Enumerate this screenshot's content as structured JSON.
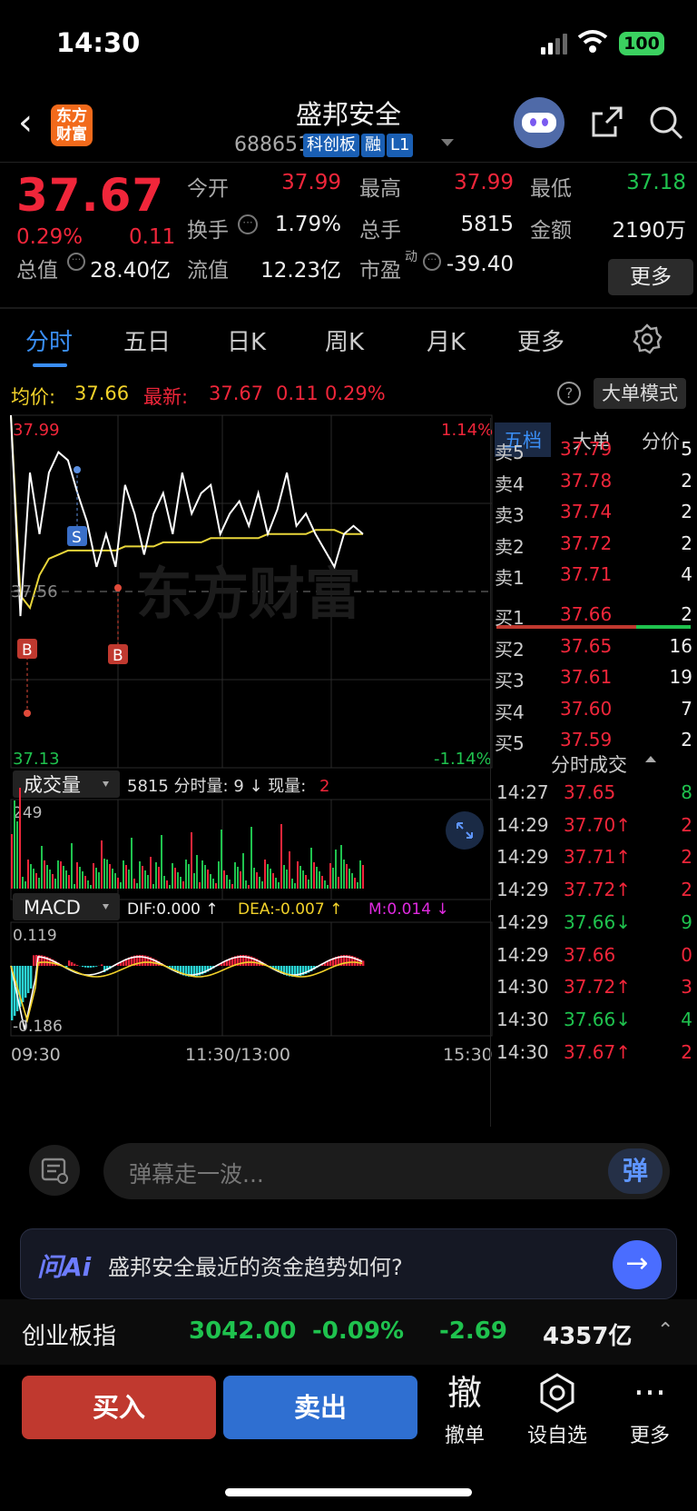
{
  "status": {
    "time": "14:30",
    "battery": "100"
  },
  "header": {
    "logo_text": "东方\n财富",
    "name": "盛邦安全",
    "code": "688651",
    "tags": [
      "科创板",
      "融",
      "L1"
    ]
  },
  "quote": {
    "price": "37.67",
    "change_pct": "0.29%",
    "change": "0.11",
    "fields": [
      {
        "label": "今开",
        "value": "37.99",
        "color": "red"
      },
      {
        "label": "最高",
        "value": "37.99",
        "color": "red"
      },
      {
        "label": "最低",
        "value": "37.18",
        "color": "green"
      },
      {
        "label": "换手",
        "value": "1.79%",
        "color": "white"
      },
      {
        "label": "总手",
        "value": "5815",
        "color": "white"
      },
      {
        "label": "金额",
        "value": "2190万",
        "color": "white"
      },
      {
        "label": "总值",
        "value": "28.40亿",
        "color": "white"
      },
      {
        "label": "流值",
        "value": "12.23亿",
        "color": "white"
      },
      {
        "label": "市盈",
        "sup": "动",
        "value": "-39.40",
        "color": "white"
      }
    ],
    "more": "更多"
  },
  "tabs": [
    "分时",
    "五日",
    "日K",
    "周K",
    "月K",
    "更多"
  ],
  "infoline": {
    "avg_label": "均价:",
    "avg": "37.66",
    "last_label": "最新:",
    "last": "37.67",
    "chg": "0.11",
    "pct": "0.29%",
    "help": "?",
    "big_order_mode": "大单模式"
  },
  "chart_labels": {
    "high": "37.99",
    "high_pct": "1.14%",
    "mid": "37.56",
    "low": "37.13",
    "low_pct": "-1.14%",
    "watermark": "东方财富",
    "marker_s": "S",
    "marker_b": "B",
    "vol_tab": "成交量",
    "vol_info_a": "5815 分时量: 9 ↓ 现量:",
    "vol_info_b": "2",
    "vol_max": "249",
    "macd_tab": "MACD",
    "dif": "DIF:0.000 ↑",
    "dea": "DEA:-0.007 ↑",
    "m": "M:0.014 ↓",
    "macd_max": "0.119",
    "macd_min": "-0.186",
    "t_start": "09:30",
    "t_mid": "11:30/13:00",
    "t_end": "15:30"
  },
  "chart_data": {
    "type": "line",
    "x_label": "time",
    "ylim": [
      37.13,
      37.99
    ],
    "series": [
      {
        "name": "最新",
        "values": [
          37.99,
          37.5,
          37.85,
          37.7,
          37.85,
          37.9,
          37.88,
          37.8,
          37.73,
          37.62,
          37.7,
          37.62,
          37.82,
          37.75,
          37.65,
          37.75,
          37.8,
          37.7,
          37.85,
          37.75,
          37.8,
          37.82,
          37.7,
          37.75,
          37.78,
          37.72,
          37.8,
          37.7,
          37.76,
          37.85,
          37.72,
          37.75,
          37.7,
          37.66,
          37.62,
          37.7,
          37.72,
          37.7
        ]
      },
      {
        "name": "均价",
        "values": [
          37.99,
          37.55,
          37.52,
          37.6,
          37.64,
          37.65,
          37.66,
          37.66,
          37.66,
          37.66,
          37.66,
          37.66,
          37.67,
          37.67,
          37.67,
          37.67,
          37.68,
          37.68,
          37.68,
          37.68,
          37.68,
          37.69,
          37.69,
          37.69,
          37.69,
          37.69,
          37.69,
          37.7,
          37.7,
          37.7,
          37.7,
          37.7,
          37.71,
          37.71,
          37.71,
          37.7,
          37.7,
          37.7
        ]
      }
    ]
  },
  "orderbook": {
    "tabs": [
      "五档",
      "大单",
      "分价"
    ],
    "asks": [
      {
        "n": "卖5",
        "p": "37.79",
        "q": "5"
      },
      {
        "n": "卖4",
        "p": "37.78",
        "q": "2"
      },
      {
        "n": "卖3",
        "p": "37.74",
        "q": "2"
      },
      {
        "n": "卖2",
        "p": "37.72",
        "q": "2"
      },
      {
        "n": "卖1",
        "p": "37.71",
        "q": "4"
      }
    ],
    "bids": [
      {
        "n": "买1",
        "p": "37.66",
        "q": "2"
      },
      {
        "n": "买2",
        "p": "37.65",
        "q": "16"
      },
      {
        "n": "买3",
        "p": "37.61",
        "q": "19"
      },
      {
        "n": "买4",
        "p": "37.60",
        "q": "7"
      },
      {
        "n": "买5",
        "p": "37.59",
        "q": "2"
      }
    ],
    "ticks_title": "分时成交",
    "ticks": [
      {
        "t": "14:27",
        "p": "37.65",
        "q": "8",
        "qc": "green"
      },
      {
        "t": "14:29",
        "p": "37.70↑",
        "q": "2",
        "qc": "red"
      },
      {
        "t": "14:29",
        "p": "37.71↑",
        "q": "2",
        "qc": "red"
      },
      {
        "t": "14:29",
        "p": "37.72↑",
        "q": "2",
        "qc": "red"
      },
      {
        "t": "14:29",
        "p": "37.66↓",
        "q": "9",
        "qc": "green"
      },
      {
        "t": "14:29",
        "p": "37.66",
        "q": "0",
        "qc": "red"
      },
      {
        "t": "14:30",
        "p": "37.72↑",
        "q": "3",
        "qc": "red"
      },
      {
        "t": "14:30",
        "p": "37.66↓",
        "q": "4",
        "qc": "green"
      },
      {
        "t": "14:30",
        "p": "37.67↑",
        "q": "2",
        "qc": "red"
      }
    ]
  },
  "danmu": {
    "placeholder": "弹幕走一波...",
    "button": "弹"
  },
  "ai": {
    "logo": "问Ai",
    "question": "盛邦安全最近的资金趋势如何?"
  },
  "index_bar": {
    "name": "创业板指",
    "value": "3042.00",
    "pct": "-0.09%",
    "chg": "-2.69",
    "amount": "4357亿"
  },
  "actions": {
    "buy": "买入",
    "sell": "卖出",
    "cancel_icon": "撤",
    "cancel": "撤单",
    "watch": "设自选",
    "more": "更多"
  }
}
